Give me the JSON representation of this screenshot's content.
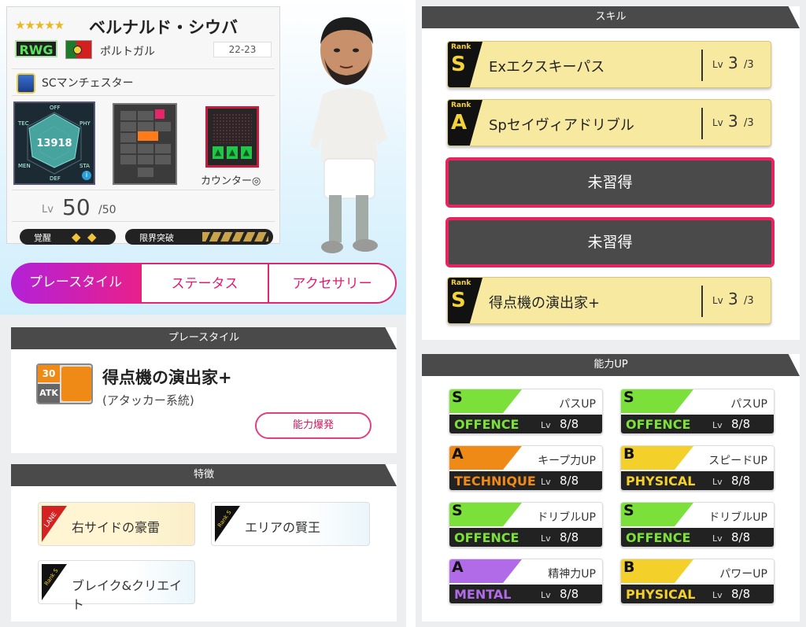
{
  "player": {
    "stars": "★★★★★",
    "name": "ベルナルド・シウバ",
    "position": "RWG",
    "country": "ポルトガル",
    "season": "22-23",
    "club": "SCマンチェスター",
    "power": "13918",
    "radar_labels": [
      "OFF",
      "PHY",
      "STA",
      "DEF",
      "MEN",
      "TEC"
    ],
    "counter_label": "カウンター◎",
    "level_label": "Lv",
    "level": "50",
    "level_max": "/50",
    "awaken_label": "覚醒",
    "limit_label": "限界突破",
    "info_icon": "i"
  },
  "tabs": {
    "play_style": "プレースタイル",
    "status": "ステータス",
    "accessory": "アクセサリー"
  },
  "playstyle_panel": {
    "header": "プレースタイル",
    "badge_num": "30",
    "badge_cat": "ATK",
    "name": "得点機の演出家+",
    "sub": "(アタッカー系統)",
    "burst_button": "能力爆発"
  },
  "traits_panel": {
    "header": "特徴",
    "items": [
      {
        "label": "右サイドの豪雷",
        "tag": "LANE"
      },
      {
        "label": "エリアの賢王",
        "tag": "Rank S"
      },
      {
        "label": "ブレイク&クリエイト",
        "tag": "Rank S"
      }
    ]
  },
  "skills_panel": {
    "header": "スキル",
    "rank_word": "Rank",
    "lv_word": "Lv",
    "items": [
      {
        "rank": "S",
        "name": "Exエクスキーパス",
        "lv": "3",
        "max": "/3"
      },
      {
        "rank": "A",
        "name": "Spセイヴィアドリブル",
        "lv": "3",
        "max": "/3"
      },
      {
        "unlearned": "未習得"
      },
      {
        "unlearned": "未習得"
      },
      {
        "rank": "S",
        "name": "得点機の演出家+",
        "lv": "3",
        "max": "/3"
      }
    ]
  },
  "ability_panel": {
    "header": "能力UP",
    "lv_word": "Lv",
    "items": [
      {
        "rank": "S",
        "name": "パスUP",
        "category": "OFFENCE",
        "lv": "8/8",
        "color": "#7be13a",
        "cat_color": "#7be13a"
      },
      {
        "rank": "S",
        "name": "パスUP",
        "category": "OFFENCE",
        "lv": "8/8",
        "color": "#7be13a",
        "cat_color": "#7be13a"
      },
      {
        "rank": "A",
        "name": "キープ力UP",
        "category": "TECHNIQUE",
        "lv": "8/8",
        "color": "#f08a16",
        "cat_color": "#f08a16"
      },
      {
        "rank": "B",
        "name": "スピードUP",
        "category": "PHYSICAL",
        "lv": "8/8",
        "color": "#f3d02a",
        "cat_color": "#f3d02a"
      },
      {
        "rank": "S",
        "name": "ドリブルUP",
        "category": "OFFENCE",
        "lv": "8/8",
        "color": "#7be13a",
        "cat_color": "#7be13a"
      },
      {
        "rank": "S",
        "name": "ドリブルUP",
        "category": "OFFENCE",
        "lv": "8/8",
        "color": "#7be13a",
        "cat_color": "#7be13a"
      },
      {
        "rank": "A",
        "name": "精神力UP",
        "category": "MENTAL",
        "lv": "8/8",
        "color": "#b16ae8",
        "cat_color": "#b16ae8"
      },
      {
        "rank": "B",
        "name": "パワーUP",
        "category": "PHYSICAL",
        "lv": "8/8",
        "color": "#f3d02a",
        "cat_color": "#f3d02a"
      }
    ]
  },
  "colors": {
    "accent_pink": "#e2256f",
    "accent_purple": "#b321d8",
    "skill_bg": "#f7e9a0",
    "header_bg": "#4a4a4a"
  }
}
